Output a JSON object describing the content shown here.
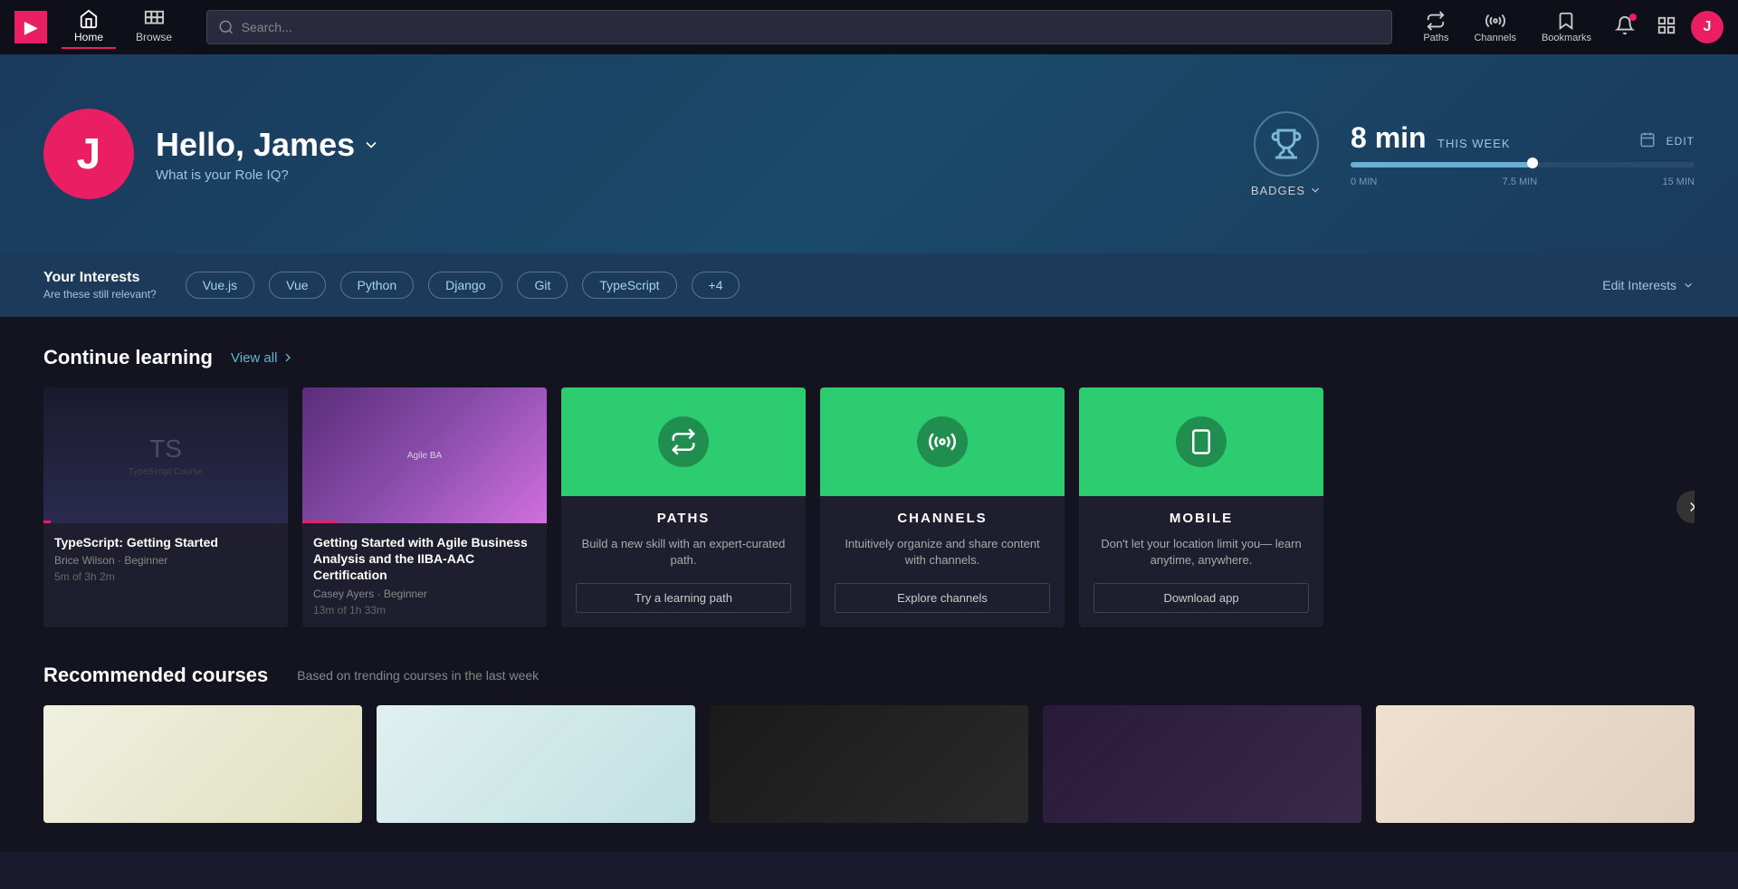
{
  "app": {
    "logo": "▶",
    "logo_bg": "#e91e63"
  },
  "nav": {
    "home_label": "Home",
    "browse_label": "Browse",
    "search_placeholder": "Search...",
    "paths_label": "Paths",
    "channels_label": "Channels",
    "bookmarks_label": "Bookmarks",
    "avatar_letter": "J"
  },
  "hero": {
    "greeting": "Hello, James",
    "role_prompt": "What is your Role IQ?",
    "badges_label": "BADGES",
    "week_label": "THIS WEEK",
    "edit_label": "EDIT",
    "min_value": "8 min",
    "progress_0": "0 MIN",
    "progress_mid": "7.5 MIN",
    "progress_max": "15 MIN",
    "progress_percent": 53
  },
  "interests": {
    "title": "Your Interests",
    "subtitle": "Are these still relevant?",
    "tags": [
      "Vue.js",
      "Vue",
      "Python",
      "Django",
      "Git",
      "TypeScript",
      "+4"
    ],
    "edit_label": "Edit Interests"
  },
  "continue_learning": {
    "title": "Continue learning",
    "view_all": "View all",
    "courses": [
      {
        "name": "TypeScript: Getting Started",
        "author": "Brice Wilson",
        "level": "Beginner",
        "progress_text": "5m of 3h 2m",
        "progress_pct": 3,
        "thumb_style": "ts"
      },
      {
        "name": "Getting Started with Agile Business Analysis and the IIBA-AAC Certification",
        "author": "Casey Ayers",
        "level": "Beginner",
        "progress_text": "13m of 1h 33m",
        "progress_pct": 14,
        "thumb_style": "agile"
      }
    ],
    "promos": [
      {
        "id": "paths",
        "icon": "paths",
        "title": "PATHS",
        "desc": "Build a new skill with an expert-curated path.",
        "btn_label": "Try a learning path"
      },
      {
        "id": "channels",
        "icon": "channels",
        "title": "CHANNELS",
        "desc": "Intuitively organize and share content with channels.",
        "btn_label": "Explore channels"
      },
      {
        "id": "mobile",
        "icon": "mobile",
        "title": "MOBILE",
        "desc": "Don't let your location limit you— learn anytime, anywhere.",
        "btn_label": "Download app"
      }
    ]
  },
  "recommended": {
    "title": "Recommended courses",
    "subtitle": "Based on trending courses in the last week"
  }
}
